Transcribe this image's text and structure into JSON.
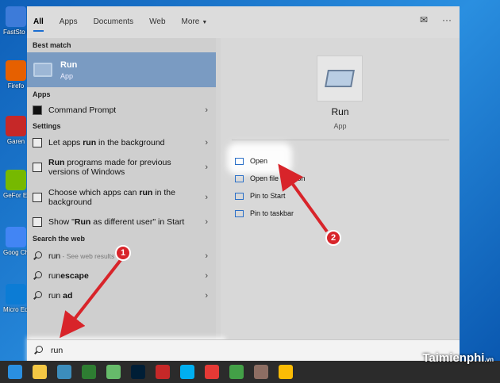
{
  "desktop": {
    "icons": [
      {
        "label": "FastSto Captu",
        "color": "#3d7bd9"
      },
      {
        "label": "Firefo",
        "color": "#e66000"
      },
      {
        "label": "Garen",
        "color": "#c62828"
      },
      {
        "label": "GeFor Experie",
        "color": "#76b900"
      },
      {
        "label": "Goog Chron",
        "color": "#4285f4"
      },
      {
        "label": "Micro Edge",
        "color": "#0c7cd5"
      }
    ]
  },
  "tabs": {
    "items": [
      "All",
      "Apps",
      "Documents",
      "Web",
      "More"
    ],
    "more_caret": "▼",
    "feedback_icon": "feedback-icon",
    "options_icon": "more-options-icon",
    "options_glyph": "···"
  },
  "best_match": {
    "label": "Best match",
    "title": "Run",
    "subtitle": "App"
  },
  "apps": {
    "label": "Apps",
    "items": [
      {
        "text": "Command Prompt"
      }
    ]
  },
  "settings": {
    "label": "Settings",
    "items": [
      {
        "pre": "Let apps ",
        "hl": "run",
        "post": " in the background"
      },
      {
        "pre": "",
        "hl": "Run",
        "post": " programs made for previous versions of Windows"
      },
      {
        "pre": "Choose which apps can ",
        "hl": "run",
        "post": " in the background"
      },
      {
        "pre": "Show \"",
        "hl": "Run",
        "post": " as different user\" in Start"
      }
    ]
  },
  "web": {
    "label": "Search the web",
    "items": [
      {
        "hl": "run",
        "post": "",
        "muted": " - See web results"
      },
      {
        "hl": "run",
        "post": "escape",
        "muted": ""
      },
      {
        "hl": "run",
        "post": " ad",
        "muted": ""
      }
    ]
  },
  "preview": {
    "title": "Run",
    "subtitle": "App",
    "actions": [
      "Open",
      "Open file location",
      "Pin to Start",
      "Pin to taskbar"
    ]
  },
  "search": {
    "value": "run"
  },
  "annotations": {
    "badge1": "1",
    "badge2": "2"
  },
  "taskbar": {
    "icons": [
      {
        "name": "start-icon",
        "color": "#2a8fe0"
      },
      {
        "name": "file-explorer-icon",
        "color": "#f3c744"
      },
      {
        "name": "taskbar-app-icon",
        "color": "#3c8dbc"
      },
      {
        "name": "taskbar-app-icon",
        "color": "#2e7d32"
      },
      {
        "name": "taskbar-app-icon",
        "color": "#66bb6a"
      },
      {
        "name": "photoshop-icon",
        "color": "#001e36"
      },
      {
        "name": "taskbar-app-icon",
        "color": "#c62828"
      },
      {
        "name": "skype-icon",
        "color": "#00aff0"
      },
      {
        "name": "taskbar-app-icon",
        "color": "#e53935"
      },
      {
        "name": "taskbar-app-icon",
        "color": "#43a047"
      },
      {
        "name": "taskbar-app-icon",
        "color": "#8d6e63"
      },
      {
        "name": "chrome-icon",
        "color": "#fbbc05"
      }
    ],
    "watermark": "Taimienphi",
    "watermark_suffix": ".vn"
  },
  "colors": {
    "accent": "#1a6dd1",
    "selection": "#7a9bc2",
    "annotation": "#d8242a"
  }
}
